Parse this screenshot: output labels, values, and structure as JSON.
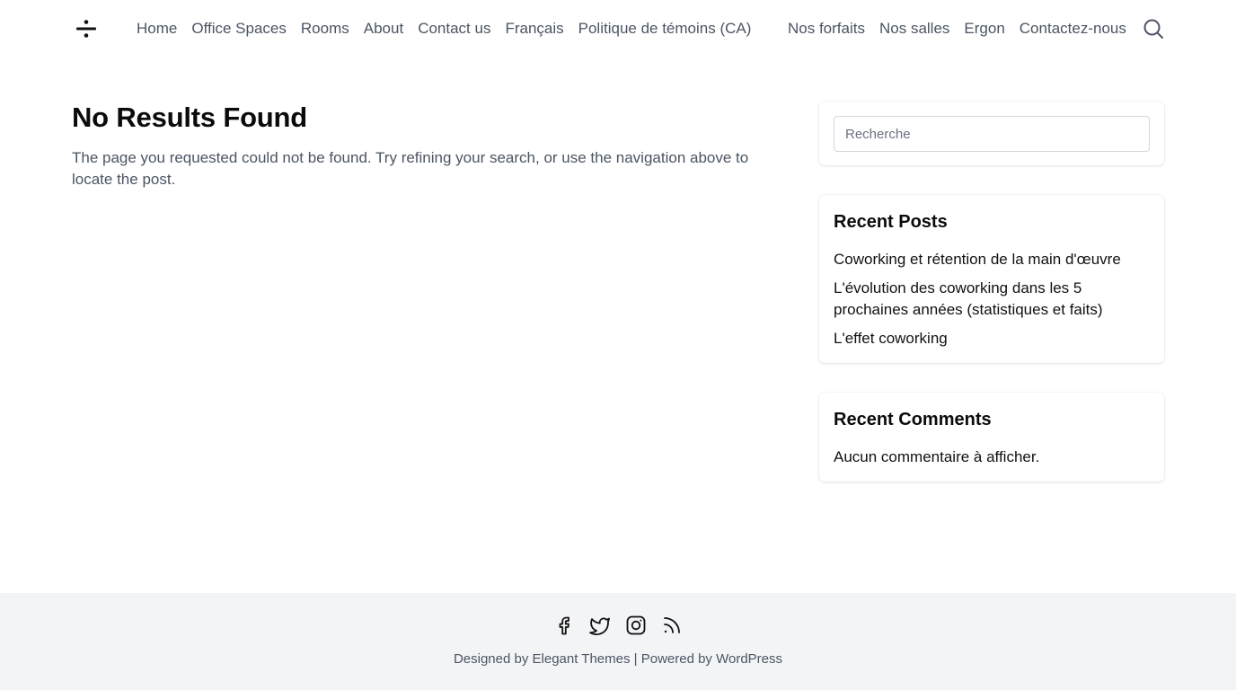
{
  "header": {
    "logo_icon": "divide-icon",
    "nav_left": [
      "Home",
      "Office Spaces",
      "Rooms",
      "About",
      "Contact us",
      "Français",
      "Politique de témoins (CA)"
    ],
    "nav_right": [
      "Nos forfaits",
      "Nos salles",
      "Ergon",
      "Contactez-nous"
    ],
    "search_icon": "search-icon"
  },
  "main": {
    "title": "No Results Found",
    "description": "The page you requested could not be found. Try refining your search, or use the navigation above to locate the post."
  },
  "sidebar": {
    "search": {
      "placeholder": "Recherche"
    },
    "recent_posts": {
      "title": "Recent Posts",
      "items": [
        "Coworking et rétention de la main d'œuvre",
        "L'évolution des coworking dans les 5 prochaines années (statistiques et faits)",
        "L'effet coworking"
      ]
    },
    "recent_comments": {
      "title": "Recent Comments",
      "empty_text": "Aucun commentaire à afficher."
    }
  },
  "footer": {
    "social_icons": [
      "facebook-icon",
      "twitter-icon",
      "instagram-icon",
      "rss-icon"
    ],
    "designed_by_prefix": "Designed by ",
    "designed_by_link": "Elegant Themes",
    "separator": " | ",
    "powered_by_prefix": "Powered by ",
    "powered_by_link": "WordPress"
  },
  "colors": {
    "text_primary": "#111111",
    "text_muted": "#4b5563",
    "footer_bg": "#f3f4f6",
    "page_bg": "#ffffff"
  }
}
